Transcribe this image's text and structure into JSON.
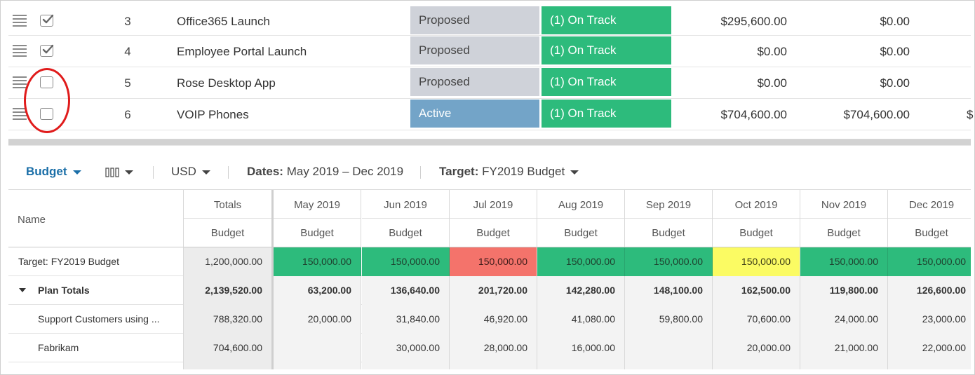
{
  "projects": [
    {
      "checked": true,
      "num": "3",
      "name": "Office365 Launch",
      "state": "Proposed",
      "state_kind": "proposed",
      "health": "(1) On Track",
      "cost": "$295,600.00",
      "actual": "$0.00",
      "cutoff": ""
    },
    {
      "checked": true,
      "num": "4",
      "name": "Employee Portal Launch",
      "state": "Proposed",
      "state_kind": "proposed",
      "health": "(1) On Track",
      "cost": "$0.00",
      "actual": "$0.00",
      "cutoff": ""
    },
    {
      "checked": false,
      "num": "5",
      "name": "Rose Desktop App",
      "state": "Proposed",
      "state_kind": "proposed",
      "health": "(1) On Track",
      "cost": "$0.00",
      "actual": "$0.00",
      "cutoff": ""
    },
    {
      "checked": false,
      "num": "6",
      "name": "VOIP Phones",
      "state": "Active",
      "state_kind": "active",
      "health": "(1) On Track",
      "cost": "$704,600.00",
      "actual": "$704,600.00",
      "cutoff": "$"
    }
  ],
  "colors": {
    "proposed": "#cfd2d9",
    "active": "#73a4c8",
    "on_track": "#2dbb7c",
    "over": "#f4736b",
    "warning": "#fbfb63",
    "highlight_ring": "#e01b1b",
    "toolbar_accent": "#1b6fa8"
  },
  "toolbar": {
    "view_label": "Budget",
    "columns_icon": "column-chooser-icon",
    "currency": "USD",
    "dates_label": "Dates:",
    "dates_value": "May 2019 – Dec 2019",
    "target_label": "Target:",
    "target_value": "FY2019 Budget"
  },
  "grid": {
    "name_header": "Name",
    "totals_header": "Totals",
    "sub_header": "Budget",
    "months": [
      "May 2019",
      "Jun 2019",
      "Jul 2019",
      "Aug 2019",
      "Sep 2019",
      "Oct 2019",
      "Nov 2019",
      "Dec 2019"
    ],
    "rows": [
      {
        "name": "Target: FY2019 Budget",
        "kind": "target",
        "total": "1,200,000.00",
        "values": [
          "150,000.00",
          "150,000.00",
          "150,000.00",
          "150,000.00",
          "150,000.00",
          "150,000.00",
          "150,000.00",
          "150,000.00"
        ],
        "status": [
          "green",
          "green",
          "red",
          "green",
          "green",
          "yellow",
          "green",
          "green"
        ]
      },
      {
        "name": "Plan Totals",
        "kind": "totals",
        "total": "2,139,520.00",
        "values": [
          "63,200.00",
          "136,640.00",
          "201,720.00",
          "142,280.00",
          "148,100.00",
          "162,500.00",
          "119,800.00",
          "126,600.00"
        ]
      },
      {
        "name": "Support Customers using ...",
        "kind": "item",
        "total": "788,320.00",
        "values": [
          "20,000.00",
          "31,840.00",
          "46,920.00",
          "41,080.00",
          "59,800.00",
          "70,600.00",
          "24,000.00",
          "23,000.00"
        ]
      },
      {
        "name": "Fabrikam",
        "kind": "item",
        "total": "704,600.00",
        "values": [
          "",
          "30,000.00",
          "28,000.00",
          "16,000.00",
          "",
          "20,000.00",
          "21,000.00",
          "22,000.00"
        ]
      }
    ]
  }
}
